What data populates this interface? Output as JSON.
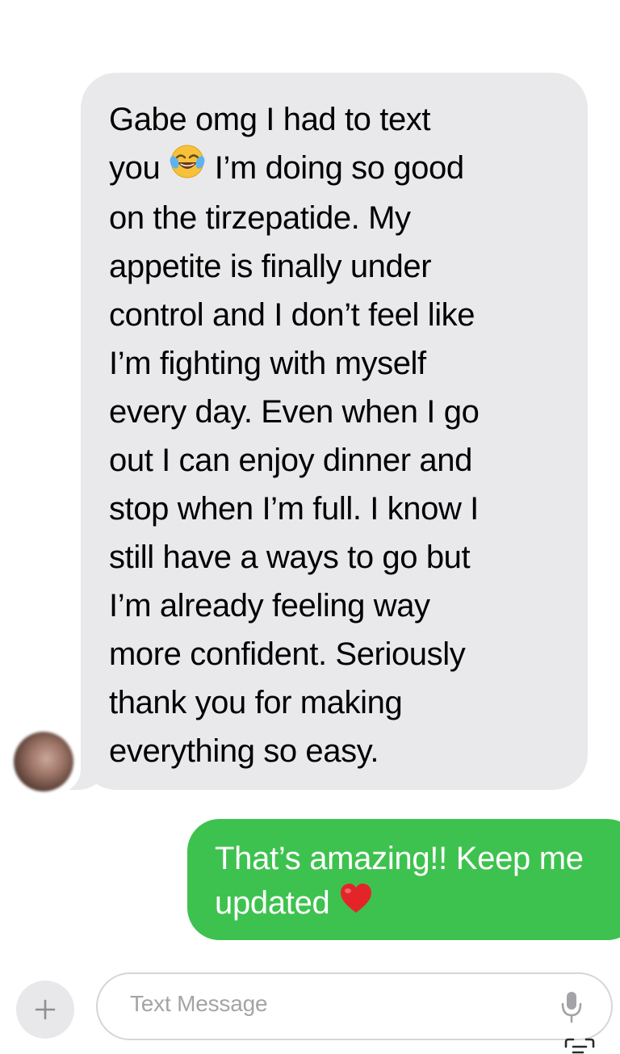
{
  "conversation": {
    "incoming_message": {
      "text_before_emoji": "Gabe omg I had to text\nyou ",
      "emoji": "face-with-tears-of-joy",
      "text_after_emoji": " I’m doing so good\non the tirzepatide. My\nappetite is finally under\ncontrol and I don’t feel like\nI’m fighting with myself\nevery day. Even when I go\nout I can enjoy dinner and\nstop when I’m full. I know I\nstill have a ways to go but\nI’m already feeling way\nmore confident. Seriously\nthank you for making\neverything so easy."
    },
    "outgoing_message": {
      "text": "That’s amazing!! Keep me updated ",
      "emoji": "red-heart"
    }
  },
  "composer": {
    "placeholder": "Text Message",
    "plus_icon": "plus-icon",
    "mic_icon": "microphone-icon"
  },
  "colors": {
    "incoming_bubble": "#e9e9eb",
    "outgoing_bubble": "#3ec24f",
    "placeholder": "#a4a4a8"
  }
}
